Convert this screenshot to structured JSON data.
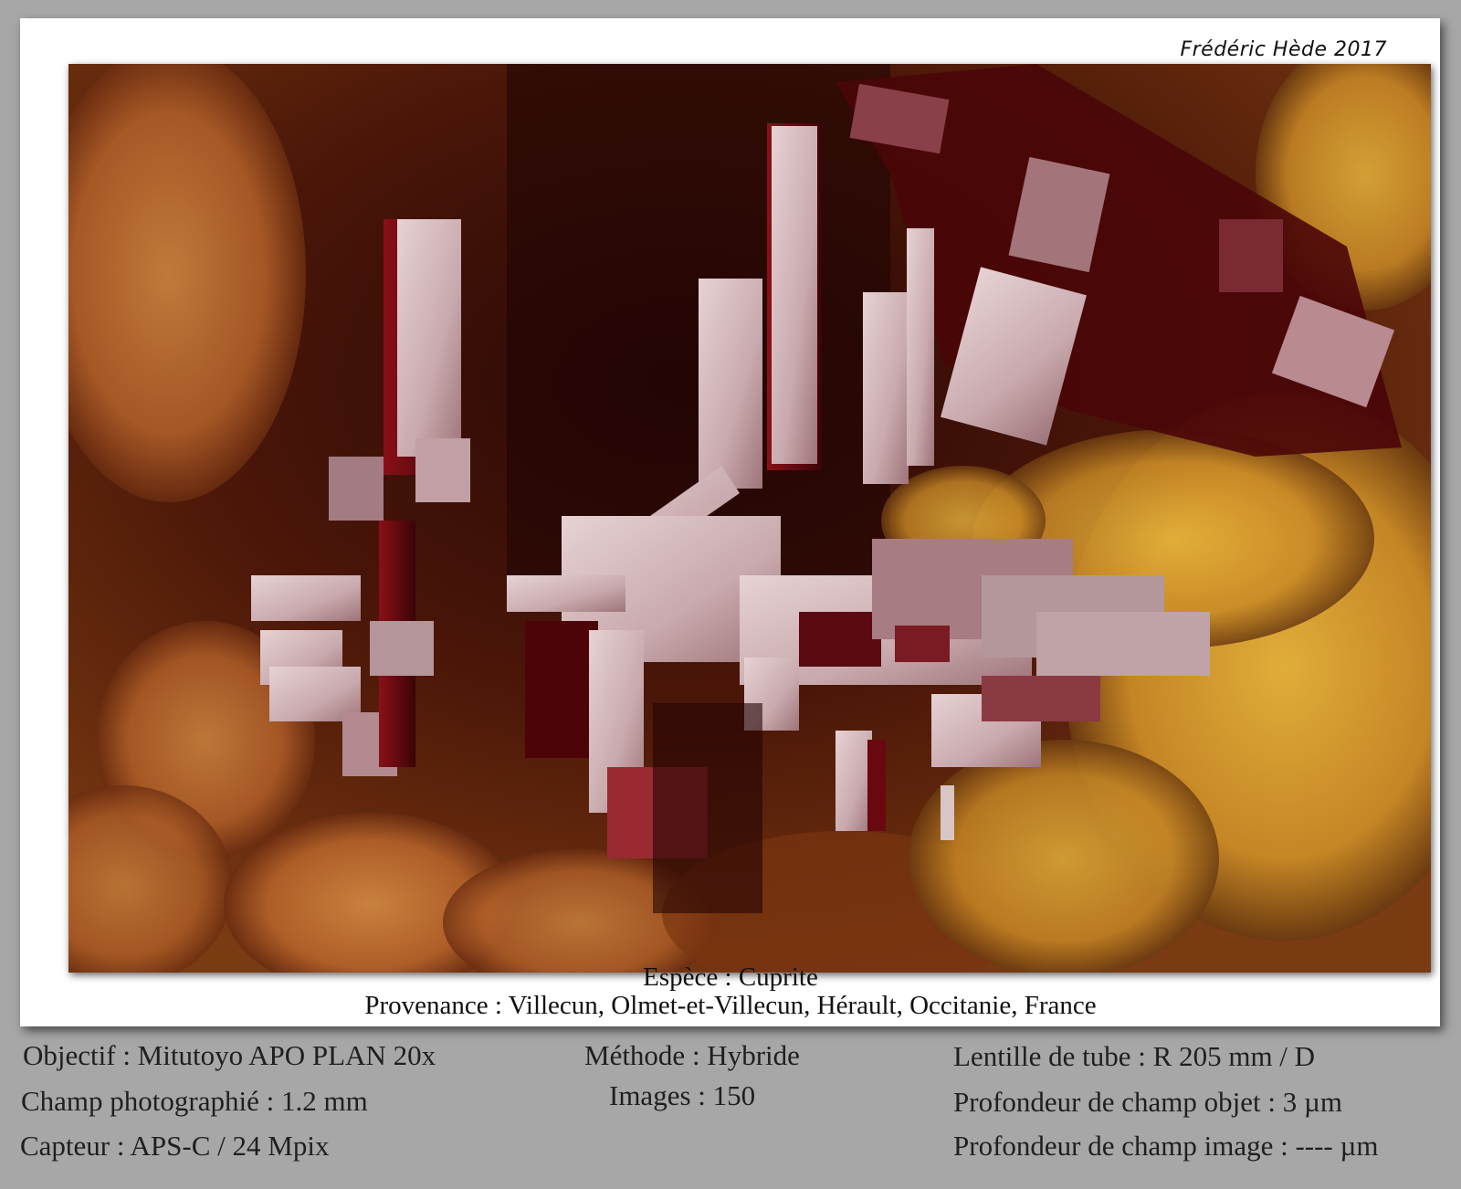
{
  "signature": "Frédéric Hède 2017",
  "caption": {
    "species": "Espèce : Cuprite",
    "origin": "Provenance : Villecun, Olmet-et-Villecun, Hérault, Occitanie, France"
  },
  "technical": {
    "col1": [
      "Objectif : Mitutoyo APO PLAN 20x",
      "Champ photographié : 1.2 mm",
      "Capteur : APS-C / 24 Mpix"
    ],
    "col2": [
      "Méthode : Hybride",
      "Images : 150"
    ],
    "col3": [
      "Lentille de tube : R 205 mm / D",
      "Profondeur de champ objet : 3 µm",
      "Profondeur de champ image : ---- µm"
    ]
  },
  "colors": {
    "page_background": "#a7a7a7",
    "frame": "#ffffff",
    "crystal_dark": "#5a0a10",
    "crystal_highlight": "#d8bcc0",
    "matrix_orange": "#b8662a",
    "matrix_yellow": "#d9a12e"
  }
}
